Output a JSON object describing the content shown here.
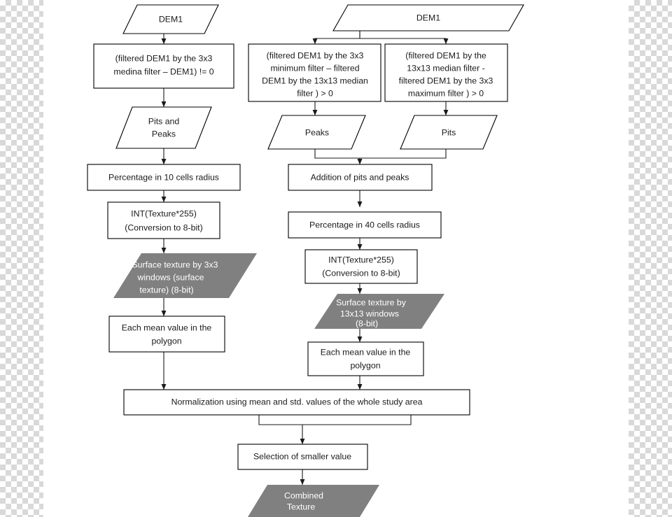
{
  "diagram": {
    "title": "Surface texture processing flowchart",
    "colors": {
      "box_fill": "#ffffff",
      "box_stroke": "#000000",
      "grey_fill": "#808080",
      "text": "#1a1a1a",
      "text_on_grey": "#ffffff"
    },
    "nodes": {
      "dem1_left": {
        "shape": "parallelogram",
        "lines": [
          "DEM1"
        ]
      },
      "dem1_right": {
        "shape": "parallelogram",
        "lines": [
          "DEM1"
        ]
      },
      "filter_left": {
        "shape": "rect",
        "lines": [
          "(filtered DEM1 by the 3x3",
          "medina filter – DEM1) != 0"
        ]
      },
      "filter_mid": {
        "shape": "rect",
        "lines": [
          "(filtered DEM1 by the 3x3",
          "minimum filter – filtered",
          "DEM1 by the 13x13 median",
          "filter ) > 0"
        ]
      },
      "filter_right": {
        "shape": "rect",
        "lines": [
          "(filtered DEM1 by the",
          "13x13 median filter -",
          "filtered DEM1 by the 3x3",
          "maximum filter ) > 0"
        ]
      },
      "pits_and_peaks": {
        "shape": "parallelogram",
        "lines": [
          "Pits and",
          "Peaks"
        ]
      },
      "peaks": {
        "shape": "parallelogram",
        "lines": [
          "Peaks"
        ]
      },
      "pits": {
        "shape": "parallelogram",
        "lines": [
          "Pits"
        ]
      },
      "percentage_10": {
        "shape": "rect",
        "lines": [
          "Percentage in 10 cells radius"
        ]
      },
      "addition": {
        "shape": "rect",
        "lines": [
          "Addition of pits and peaks"
        ]
      },
      "int_left": {
        "shape": "rect",
        "lines": [
          "INT(Texture*255)",
          "(Conversion to 8-bit)"
        ]
      },
      "percentage_40": {
        "shape": "rect",
        "lines": [
          "Percentage in 40 cells radius"
        ]
      },
      "surface_3x3": {
        "shape": "parallelogram-grey",
        "lines": [
          "Surface texture by 3x3",
          "windows (surface",
          "texture)  (8-bit)"
        ]
      },
      "int_right": {
        "shape": "rect",
        "lines": [
          "INT(Texture*255)",
          "(Conversion to 8-bit)"
        ]
      },
      "mean_left": {
        "shape": "rect",
        "lines": [
          "Each mean value in the",
          "polygon"
        ]
      },
      "surface_13x13": {
        "shape": "parallelogram-grey",
        "lines": [
          "Surface texture by",
          "13x13 windows",
          "(8-bit)"
        ]
      },
      "mean_right": {
        "shape": "rect",
        "lines": [
          "Each mean value in the",
          "polygon"
        ]
      },
      "normalization": {
        "shape": "rect",
        "lines": [
          "Normalization using mean and std. values of the whole study area"
        ]
      },
      "selection": {
        "shape": "rect",
        "lines": [
          "Selection of smaller value"
        ]
      },
      "combined": {
        "shape": "parallelogram-grey",
        "lines": [
          "Combined",
          "Texture"
        ]
      }
    }
  }
}
